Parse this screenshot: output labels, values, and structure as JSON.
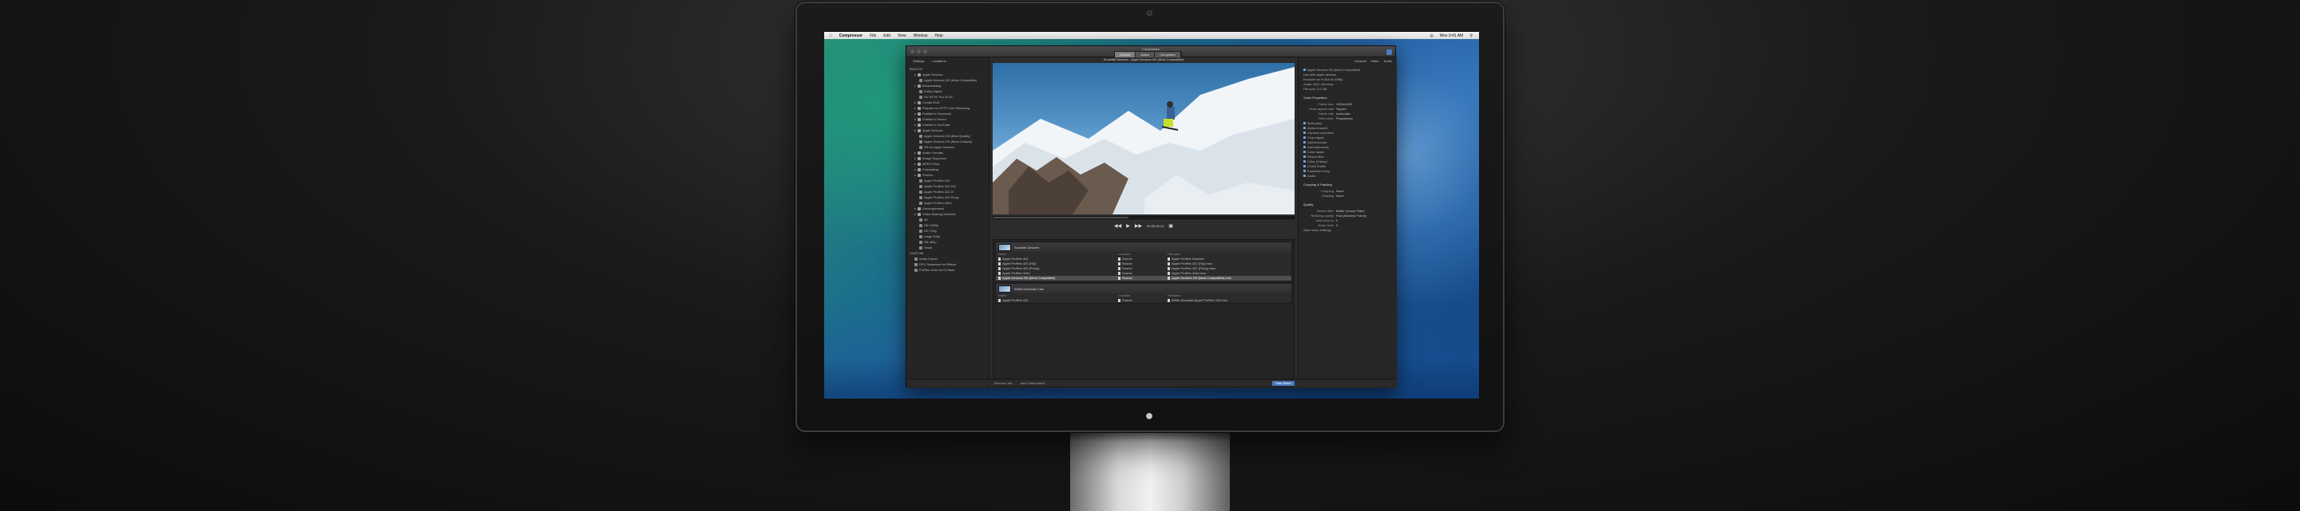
{
  "menubar": {
    "app_name": "Compressor",
    "items": [
      "File",
      "Edit",
      "View",
      "Window",
      "Help"
    ],
    "status_right": [
      "Mon 9:41 AM"
    ]
  },
  "window": {
    "title": "Compressor",
    "modes": [
      "Current",
      "Active",
      "Completed"
    ]
  },
  "sidebar": {
    "tabs": [
      "Settings",
      "Locations"
    ],
    "items": [
      {
        "label": "BUILT-IN",
        "level": 0,
        "type": "group"
      },
      {
        "label": "Apple Devices",
        "level": 1,
        "type": "folder"
      },
      {
        "label": "Apple Devices HD (Most Compatible)",
        "level": 2,
        "type": "setting"
      },
      {
        "label": "Broadcasting",
        "level": 1,
        "type": "folder"
      },
      {
        "label": "Dolby Digital",
        "level": 2,
        "type": "setting"
      },
      {
        "label": "DV NTSC Pro 29.97",
        "level": 2,
        "type": "setting"
      },
      {
        "label": "Create DVD",
        "level": 1,
        "type": "folder"
      },
      {
        "label": "Prepare for HTTP Live Streaming",
        "level": 1,
        "type": "folder"
      },
      {
        "label": "Publish to Facebook",
        "level": 1,
        "type": "folder"
      },
      {
        "label": "Publish to Vimeo",
        "level": 1,
        "type": "folder"
      },
      {
        "label": "Publish to YouTube",
        "level": 1,
        "type": "folder"
      },
      {
        "label": "Apple Devices",
        "level": 1,
        "type": "folder"
      },
      {
        "label": "Apple Devices HD (Best Quality)",
        "level": 2,
        "type": "setting"
      },
      {
        "label": "Apple Devices HD (Most Compat)",
        "level": 2,
        "type": "setting"
      },
      {
        "label": "SD for Apple Devices",
        "level": 2,
        "type": "setting"
      },
      {
        "label": "Audio Formats",
        "level": 1,
        "type": "folder"
      },
      {
        "label": "Image Sequence",
        "level": 1,
        "type": "folder"
      },
      {
        "label": "MPEG Files",
        "level": 1,
        "type": "folder"
      },
      {
        "label": "Podcasting",
        "level": 1,
        "type": "folder"
      },
      {
        "label": "ProRes",
        "level": 1,
        "type": "folder"
      },
      {
        "label": "Apple ProRes 422",
        "level": 2,
        "type": "setting"
      },
      {
        "label": "Apple ProRes 422 HQ",
        "level": 2,
        "type": "setting"
      },
      {
        "label": "Apple ProRes 422 LT",
        "level": 2,
        "type": "setting"
      },
      {
        "label": "Apple ProRes 422 Proxy",
        "level": 2,
        "type": "setting"
      },
      {
        "label": "Apple ProRes 4444",
        "level": 2,
        "type": "setting"
      },
      {
        "label": "Uncompressed",
        "level": 1,
        "type": "folder"
      },
      {
        "label": "Video Sharing Services",
        "level": 1,
        "type": "folder"
      },
      {
        "label": "4K",
        "level": 2,
        "type": "setting"
      },
      {
        "label": "HD 1080p",
        "level": 2,
        "type": "setting"
      },
      {
        "label": "HD 720p",
        "level": 2,
        "type": "setting"
      },
      {
        "label": "Large 540p",
        "level": 2,
        "type": "setting"
      },
      {
        "label": "SD 480p",
        "level": 2,
        "type": "setting"
      },
      {
        "label": "Small",
        "level": 2,
        "type": "setting"
      },
      {
        "label": "CUSTOM",
        "level": 0,
        "type": "group"
      },
      {
        "label": "Audio Export",
        "level": 1,
        "type": "setting"
      },
      {
        "label": "DPX Sequence for Mitsuh",
        "level": 1,
        "type": "setting"
      },
      {
        "label": "ProRes 4444 for DI Mast",
        "level": 1,
        "type": "setting"
      }
    ]
  },
  "viewer": {
    "title": "Snowfall Descent - Apple Devices HD (Most Compatible)",
    "timecode": "00:00:05:13",
    "progress": 0.45
  },
  "batch": {
    "columns": [
      "Name",
      "Location",
      "Filename"
    ],
    "jobs": [
      {
        "title": "Snowfall Descent",
        "rows": [
          {
            "name": "Apple ProRes 422",
            "location": "Source",
            "filename": "Apple ProRes Descent"
          },
          {
            "name": "Apple ProRes 422 (HQ)",
            "location": "Source",
            "filename": "Apple ProRes 422 (HQ).mov"
          },
          {
            "name": "Apple ProRes 422 (Proxy)",
            "location": "Source",
            "filename": "Apple ProRes 422 (Proxy).mov"
          },
          {
            "name": "Apple ProRes 4444",
            "location": "Source",
            "filename": "Apple ProRes 4444.mov"
          },
          {
            "name": "Apple Devices HD (Most Compatible)",
            "location": "Source",
            "filename": "Apple Devices HD (Most Compatible).m4v",
            "selected": true
          }
        ]
      },
      {
        "title": "White Mountain Cam",
        "rows": [
          {
            "name": "Apple ProRes 422",
            "location": "Source",
            "filename": "White Mountain Apple ProRes 422.mov"
          }
        ]
      }
    ]
  },
  "statusbar": {
    "items": [
      "Remove Job",
      "Add Composition"
    ],
    "start_label": "Start Batch"
  },
  "inspector": {
    "tabs": [
      "General",
      "Video",
      "Audio"
    ],
    "summary": [
      "Apple Devices HD (Most Compatible)",
      "Use with Apple devices",
      "Encodes as H.264 at 1080p",
      "Audio: AAC 160 kbps",
      "File size: 2.5 GB"
    ],
    "video_header": "Video Properties",
    "video_rows": [
      {
        "label": "Frame size",
        "value": "1920x1080"
      },
      {
        "label": "Pixel aspect ratio",
        "value": "Square"
      },
      {
        "label": "Frame rate",
        "value": "Automatic"
      },
      {
        "label": "Field order",
        "value": "Progressive"
      }
    ],
    "video_extra": [
      "Multi-pass",
      "Alpha channel",
      "Gamma correction",
      "Crop edges",
      "Add timecode",
      "Add watermark",
      "Color space",
      "Resize filter",
      "Color (Clamp)",
      "H.264 Profile",
      "Keyframe every",
      "Audio"
    ],
    "crop_header": "Cropping & Padding",
    "crop_rows": [
      {
        "label": "Cropping",
        "value": "None"
      },
      {
        "label": "Padding",
        "value": "None"
      }
    ],
    "quality_header": "Quality",
    "quality_rows": [
      {
        "label": "Resize filter",
        "value": "Better (Linear Filter)"
      },
      {
        "label": "Retiming quality",
        "value": "Fast (Nearest Frame)"
      },
      {
        "label": "Add noise to",
        "value": "0"
      },
      {
        "label": "Noise level",
        "value": "0"
      }
    ],
    "footer": "Save video settings"
  }
}
